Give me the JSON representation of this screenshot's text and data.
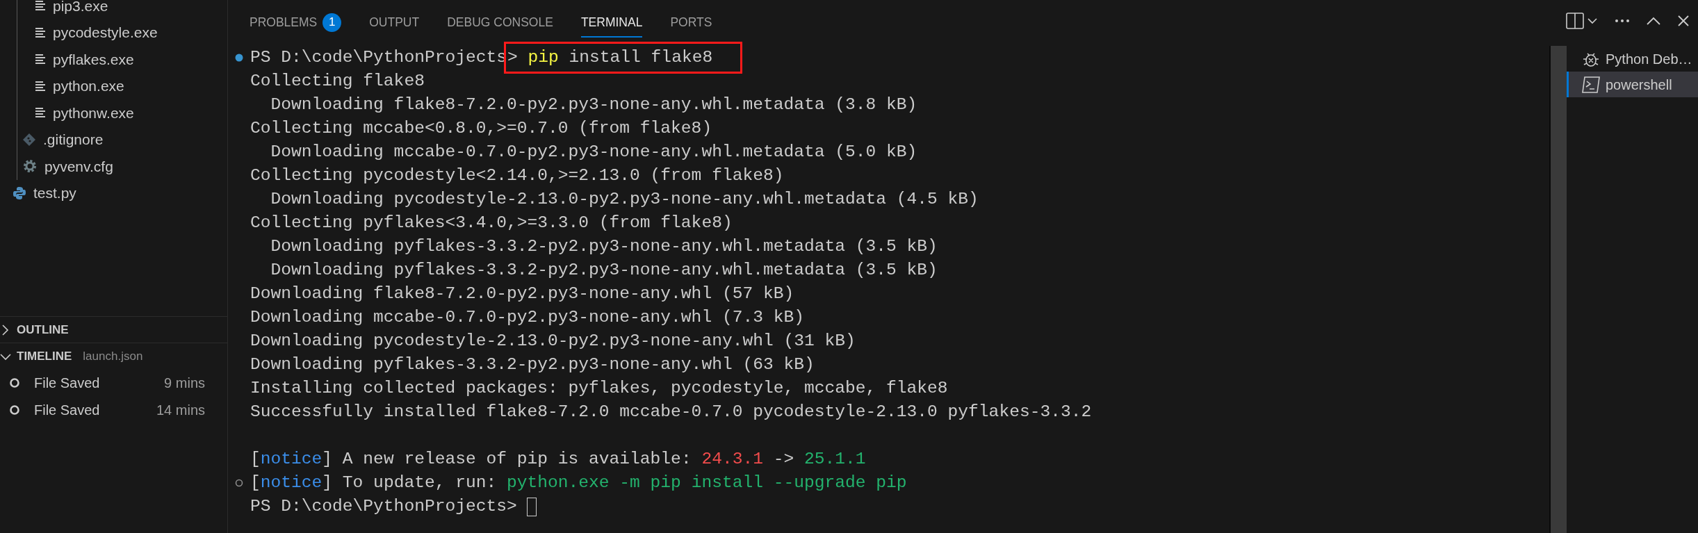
{
  "sidebar": {
    "tree": [
      {
        "children": [
          {
            "children": [
              {
                "label": "pip3.exe",
                "kind": "exe"
              },
              {
                "label": "pycodestyle.exe",
                "kind": "exe"
              },
              {
                "label": "pyflakes.exe",
                "kind": "exe"
              },
              {
                "label": "python.exe",
                "kind": "exe"
              },
              {
                "label": "pythonw.exe",
                "kind": "exe"
              }
            ]
          },
          {
            "label": ".gitignore",
            "kind": "git"
          },
          {
            "label": "pyvenv.cfg",
            "kind": "config"
          }
        ]
      },
      {
        "label": "test.py",
        "kind": "python"
      }
    ],
    "sections": [
      {
        "title": "OUTLINE",
        "expanded": false
      },
      {
        "title": "TIMELINE",
        "expanded": true,
        "subtitle": "launch.json",
        "entries": [
          {
            "label": "File Saved",
            "time": "9 mins"
          },
          {
            "label": "File Saved",
            "time": "14 mins"
          }
        ]
      }
    ]
  },
  "panel": {
    "tabs": [
      {
        "label": "PROBLEMS",
        "badge": "1",
        "selected": false
      },
      {
        "label": "OUTPUT",
        "selected": false
      },
      {
        "label": "DEBUG CONSOLE",
        "selected": false
      },
      {
        "label": "TERMINAL",
        "selected": true
      },
      {
        "label": "PORTS",
        "selected": false
      }
    ],
    "terminal": {
      "lines": [
        {
          "marked": true,
          "success": true,
          "segments": [
            {
              "text": "PS D:\\code\\PythonProjects"
            },
            {
              "kind": "box",
              "segments": [
                {
                  "text": "> "
                },
                {
                  "text": "pip",
                  "kind": "command"
                },
                {
                  "text": " install flake8"
                }
              ]
            }
          ]
        },
        {
          "segments": [
            {
              "text": "Collecting flake8"
            }
          ]
        },
        {
          "segments": [
            {
              "text": "  Downloading flake8-7.2.0-py2.py3-none-any.whl.metadata (3.8 kB)"
            }
          ]
        },
        {
          "segments": [
            {
              "text": "Collecting mccabe<0.8.0,>=0.7.0 (from flake8)"
            }
          ]
        },
        {
          "segments": [
            {
              "text": "  Downloading mccabe-0.7.0-py2.py3-none-any.whl.metadata (5.0 kB)"
            }
          ]
        },
        {
          "segments": [
            {
              "text": "Collecting pycodestyle<2.14.0,>=2.13.0 (from flake8)"
            }
          ]
        },
        {
          "segments": [
            {
              "text": "  Downloading pycodestyle-2.13.0-py2.py3-none-any.whl.metadata (4.5 kB)"
            }
          ]
        },
        {
          "segments": [
            {
              "text": "Collecting pyflakes<3.4.0,>=3.3.0 (from flake8)"
            }
          ]
        },
        {
          "segments": [
            {
              "text": "  Downloading pyflakes-3.3.2-py2.py3-none-any.whl.metadata (3.5 kB)"
            }
          ]
        },
        {
          "segments": [
            {
              "text": "  Downloading pyflakes-3.3.2-py2.py3-none-any.whl.metadata (3.5 kB)"
            }
          ]
        },
        {
          "segments": [
            {
              "text": "Downloading flake8-7.2.0-py2.py3-none-any.whl (57 kB)"
            }
          ]
        },
        {
          "segments": [
            {
              "text": "Downloading mccabe-0.7.0-py2.py3-none-any.whl (7.3 kB)"
            }
          ]
        },
        {
          "segments": [
            {
              "text": "Downloading pycodestyle-2.13.0-py2.py3-none-any.whl (31 kB)"
            }
          ]
        },
        {
          "segments": [
            {
              "text": "Downloading pyflakes-3.3.2-py2.py3-none-any.whl (63 kB)"
            }
          ]
        },
        {
          "segments": [
            {
              "text": "Installing collected packages: pyflakes, pycodestyle, mccabe, flake8"
            }
          ]
        },
        {
          "segments": [
            {
              "text": "Successfully installed flake8-7.2.0 mccabe-0.7.0 pycodestyle-2.13.0 pyflakes-3.3.2"
            }
          ]
        },
        {
          "kind": "blank"
        },
        {
          "segments": [
            {
              "text": "["
            },
            {
              "text": "notice",
              "kind": "notice"
            },
            {
              "text": "] A new release of pip is available: "
            },
            {
              "text": "24.3.1",
              "kind": "old"
            },
            {
              "text": " -> "
            },
            {
              "text": "25.1.1",
              "kind": "new"
            }
          ]
        },
        {
          "marked": true,
          "success": false,
          "segments": [
            {
              "text": "["
            },
            {
              "text": "notice",
              "kind": "notice"
            },
            {
              "text": "] To update, run: "
            },
            {
              "text": "python.exe -m pip install --upgrade pip",
              "kind": "new"
            }
          ]
        },
        {
          "cursor": true,
          "segments": [
            {
              "text": "PS D:\\code\\PythonProjects> "
            }
          ]
        }
      ]
    },
    "terminal_list": [
      {
        "label": "Python Deb…",
        "kind": "debug",
        "selected": false
      },
      {
        "label": "powershell",
        "kind": "shell",
        "selected": true
      }
    ]
  }
}
